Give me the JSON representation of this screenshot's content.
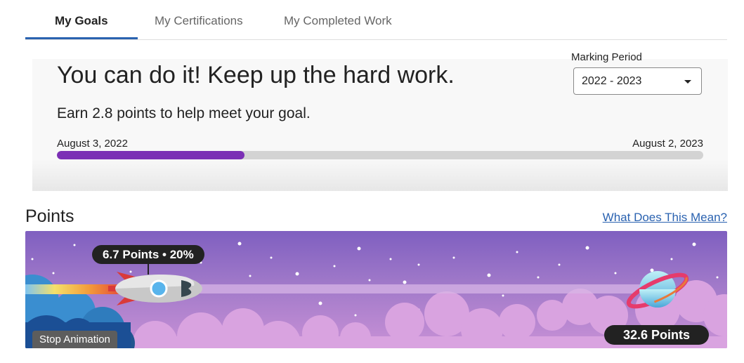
{
  "tabs": [
    {
      "label": "My Goals",
      "active": true
    },
    {
      "label": "My Certifications",
      "active": false
    },
    {
      "label": "My Completed Work",
      "active": false
    }
  ],
  "goal": {
    "headline": "You can do it! Keep up the hard work.",
    "subtext": "Earn 2.8 points to help meet your goal.",
    "start_date": "August 3, 2022",
    "end_date": "August 2, 2023",
    "progress_fraction": 0.29
  },
  "marking_period": {
    "label": "Marking Period",
    "selected": "2022 - 2023"
  },
  "points": {
    "heading": "Points",
    "help_link": "What Does This Mean?",
    "current_badge": "6.7 Points • 20%",
    "target_badge": "32.6 Points",
    "stop_animation_label": "Stop Animation"
  },
  "colors": {
    "accent": "#2a62b0",
    "progress": "#7b2fb5",
    "badge": "#222222"
  },
  "icons": {
    "dropdown": "chevron-down-icon",
    "rocket": "rocket-icon",
    "planet": "planet-icon"
  }
}
